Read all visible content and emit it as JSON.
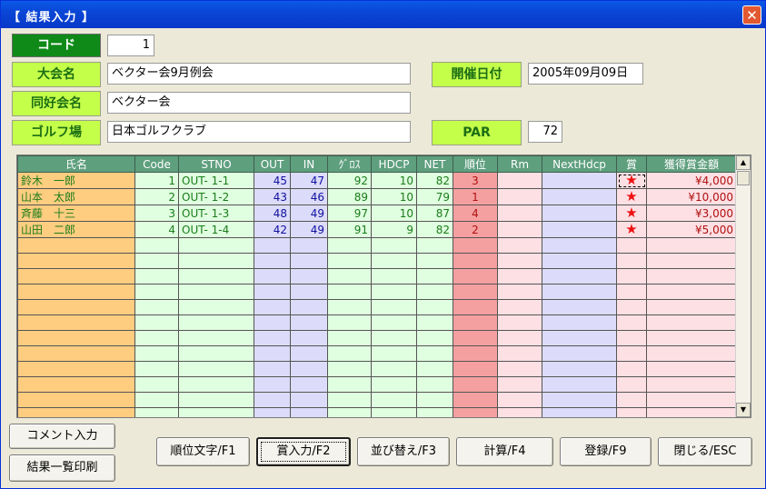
{
  "window": {
    "title": "【 結果入力 】",
    "close_glyph": "✕"
  },
  "form": {
    "code_label": "コード",
    "code_value": "1",
    "tournament_label": "大会名",
    "tournament_value": "ベクター会9月例会",
    "club_label": "同好会名",
    "club_value": "ベクター会",
    "course_label": "ゴルフ場",
    "course_value": "日本ゴルフクラブ",
    "date_label": "開催日付",
    "date_value": "2005年09月09日",
    "par_label": "PAR",
    "par_value": "72"
  },
  "grid": {
    "headers": [
      "氏名",
      "Code",
      "STNO",
      "OUT",
      "IN",
      "ｸﾞﾛｽ",
      "HDCP",
      "NET",
      "順位",
      "Rm",
      "NextHdcp",
      "賞",
      "獲得賞金額"
    ],
    "rows": [
      {
        "name": "鈴木　一郎",
        "code": "1",
        "stno": "OUT- 1-1",
        "out": "45",
        "in": "47",
        "gross": "92",
        "hdcp": "10",
        "net": "82",
        "rank": "3",
        "rm": "",
        "next_hdcp": "",
        "prize": "★",
        "amount": "¥4,000"
      },
      {
        "name": "山本　太郎",
        "code": "2",
        "stno": "OUT- 1-2",
        "out": "43",
        "in": "46",
        "gross": "89",
        "hdcp": "10",
        "net": "79",
        "rank": "1",
        "rm": "",
        "next_hdcp": "",
        "prize": "★",
        "amount": "¥10,000"
      },
      {
        "name": "斉藤　十三",
        "code": "3",
        "stno": "OUT- 1-3",
        "out": "48",
        "in": "49",
        "gross": "97",
        "hdcp": "10",
        "net": "87",
        "rank": "4",
        "rm": "",
        "next_hdcp": "",
        "prize": "★",
        "amount": "¥3,000"
      },
      {
        "name": "山田　二郎",
        "code": "4",
        "stno": "OUT- 1-4",
        "out": "42",
        "in": "49",
        "gross": "91",
        "hdcp": "9",
        "net": "82",
        "rank": "2",
        "rm": "",
        "next_hdcp": "",
        "prize": "★",
        "amount": "¥5,000"
      }
    ],
    "empty_rows": 12,
    "scroll_up_glyph": "▲",
    "scroll_down_glyph": "▼"
  },
  "buttons": {
    "comment": "コメント入力",
    "print_results": "結果一覧印刷",
    "rank_text": "順位文字/F1",
    "prize_input": "賞入力/F2",
    "sort": "並び替え/F3",
    "calculate": "計算/F4",
    "register": "登録/F9",
    "close": "閉じる/ESC"
  },
  "colors": {
    "title_bar": "#0a46d6",
    "label_dark_green": "#0f8a18",
    "label_lime": "#c4ff4a",
    "name_column": "#ffcd80",
    "green_column": "#e0ffe0",
    "blue_column": "#dcdcfa",
    "rank_column": "#f5a0a0",
    "pink_column": "#fde0e4",
    "header": "#5e9f7e",
    "star": "#ee1111"
  },
  "icons": {
    "prize": "star-icon",
    "close": "close-icon"
  }
}
